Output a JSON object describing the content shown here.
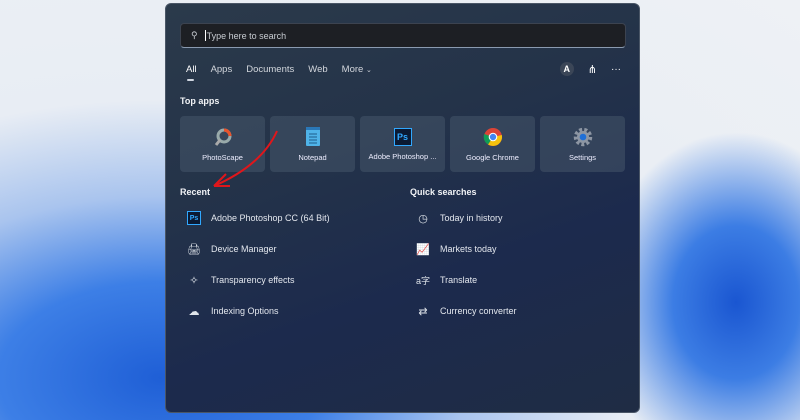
{
  "search": {
    "placeholder": "Type here to search"
  },
  "tabs": [
    "All",
    "Apps",
    "Documents",
    "Web",
    "More"
  ],
  "header_right": {
    "avatar_letter": "A",
    "more": "···"
  },
  "top_apps": {
    "title": "Top apps",
    "items": [
      "PhotoScape",
      "Notepad",
      "Adobe Photoshop ...",
      "Google Chrome",
      "Settings"
    ]
  },
  "recent": {
    "title": "Recent",
    "items": [
      "Adobe Photoshop CC (64 Bit)",
      "Device Manager",
      "Transparency effects",
      "Indexing Options"
    ]
  },
  "quick_searches": {
    "title": "Quick searches",
    "items": [
      "Today in history",
      "Markets today",
      "Translate",
      "Currency converter"
    ]
  },
  "colors": {
    "annotation_arrow": "#e0161b",
    "panel": "#243349"
  }
}
